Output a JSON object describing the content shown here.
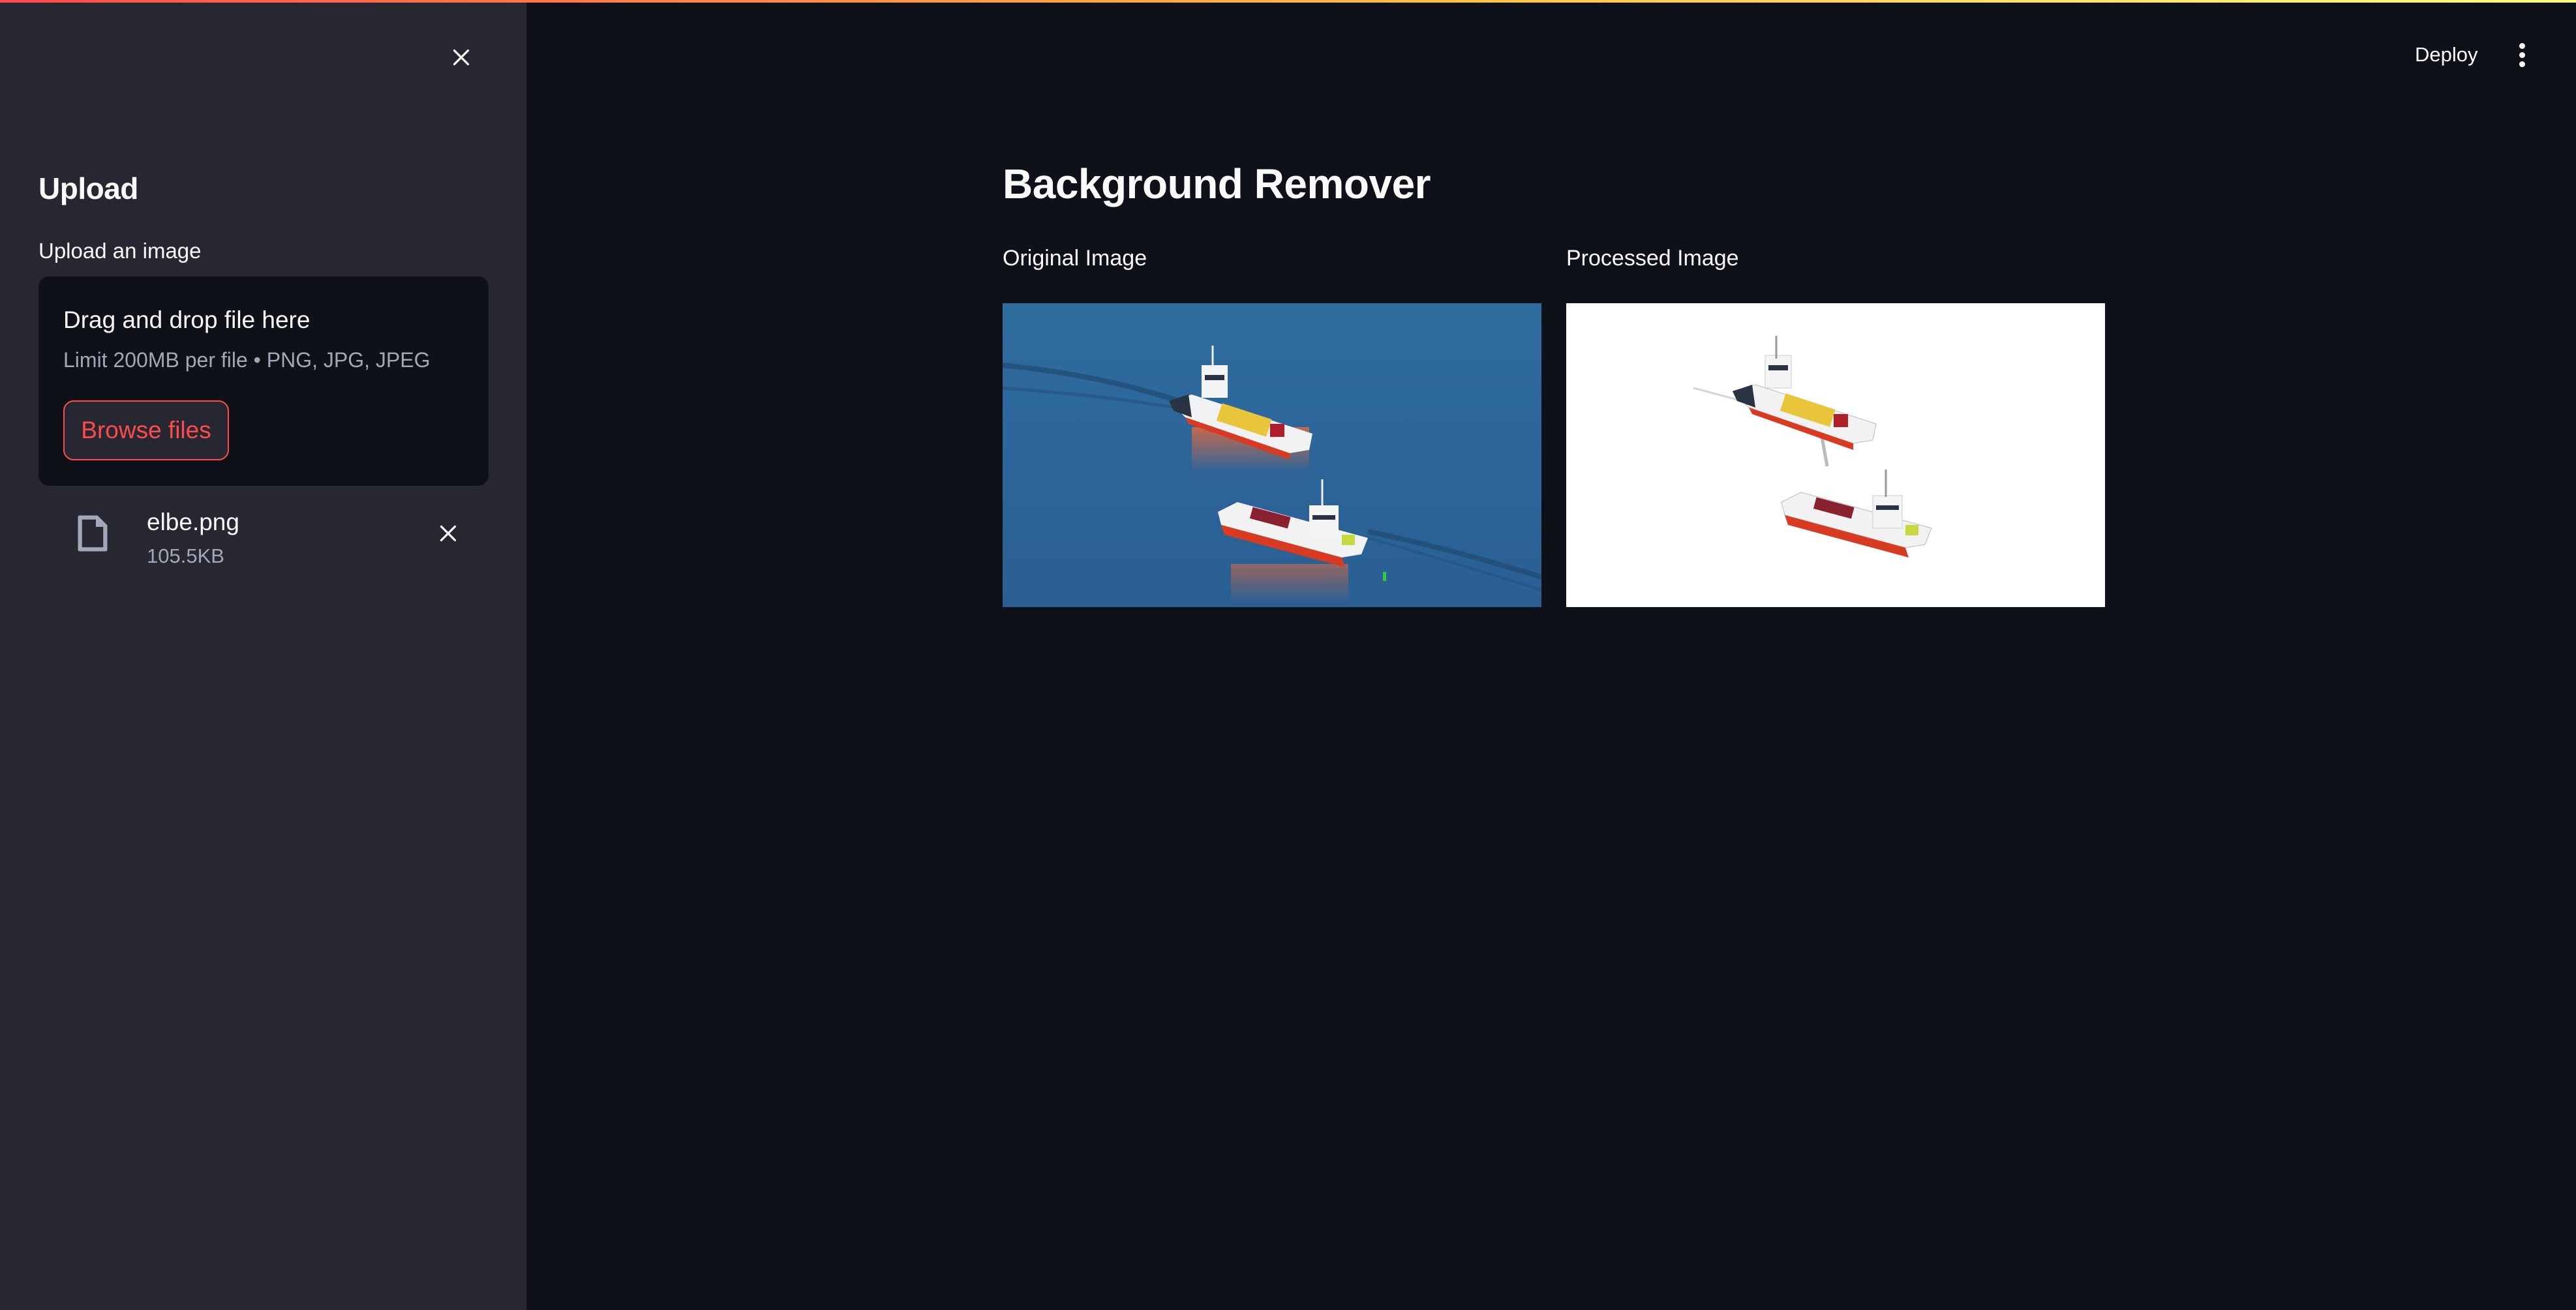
{
  "theme": {
    "accent": "#ff4b4b",
    "sidebar_bg": "#262730",
    "main_bg": "#0e1117",
    "text": "#fafafa",
    "muted_text": "#a3a8b8"
  },
  "header": {
    "deploy_label": "Deploy",
    "menu_icon": "kebab-menu-icon"
  },
  "sidebar": {
    "close_icon": "close-icon",
    "heading": "Upload",
    "uploader": {
      "label": "Upload an image",
      "dropzone_title": "Drag and drop file here",
      "dropzone_subtitle": "Limit 200MB per file • PNG, JPG, JPEG",
      "browse_label": "Browse files"
    },
    "uploaded_file": {
      "icon": "file-icon",
      "name": "elbe.png",
      "size": "105.5KB",
      "remove_icon": "close-icon"
    }
  },
  "main": {
    "title": "Background Remover",
    "columns": [
      {
        "caption": "Original Image",
        "image_alt": "Two red and white ferries on blue river water"
      },
      {
        "caption": "Processed Image",
        "image_alt": "Two ferries with background removed on white"
      }
    ]
  }
}
